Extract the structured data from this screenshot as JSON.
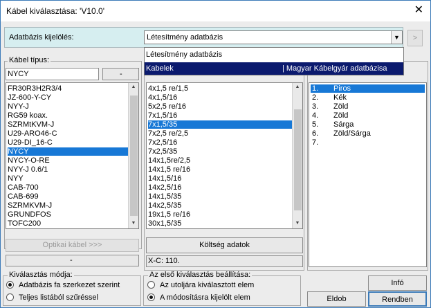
{
  "window": {
    "title": "Kábel kiválasztása: 'V10.0'"
  },
  "db_select": {
    "label": "Adatbázis kijelölés:",
    "value": "Létesítmény adatbázis",
    "next_label": ">",
    "options": [
      {
        "label": "Létesítmény adatbázis",
        "extra": ""
      },
      {
        "label": "Kabelek",
        "extra": "| Magyar Kábelgyár adatbázisa"
      }
    ]
  },
  "cable_type": {
    "title": "Kábel típus:",
    "current": "NYCY",
    "current_code": "-",
    "items": [
      "FR30R3H2R3/4",
      "JZ-600-Y-CY",
      "NYY-J",
      "RG59 koax.",
      "SZRMtKVM-J",
      "U29-ARO46-C",
      "U29-DI_16-C",
      "NYCY",
      "NYCY-O-RE",
      "NYY-J 0.6/1",
      "NYY",
      "CAB-700",
      "CAB-699",
      "SZRMKVM-J",
      "GRUNDFOS",
      "TOFC200"
    ],
    "selected_index": 7,
    "optical_button": "Optikai kábel >>>",
    "bottom_value": "-"
  },
  "section_list": {
    "items": [
      "4x1,5 re/1,5",
      "4x1,5/16",
      "5x2,5 re/16",
      "7x1,5/16",
      "7x1,5/35",
      "7x2,5 re/2,5",
      "7x2,5/16",
      "7x2,5/35",
      "14x1,5re/2,5",
      "14x1,5 re/16",
      "14x1,5/16",
      "14x2,5/16",
      "14x1,5/35",
      "14x2,5/35",
      "19x1,5 re/16",
      "30x1,5/35"
    ],
    "selected_index": 4,
    "cost_button": "Költség adatok",
    "status": "X-C:  110."
  },
  "wire_colors": {
    "items": [
      {
        "num": "1.",
        "color": "Piros"
      },
      {
        "num": "2.",
        "color": "Kék"
      },
      {
        "num": "3.",
        "color": "Zöld"
      },
      {
        "num": "4.",
        "color": "Zöld"
      },
      {
        "num": "5.",
        "color": "Sárga"
      },
      {
        "num": "6.",
        "color": "Zöld/Sárga"
      },
      {
        "num": "7.",
        "color": ""
      }
    ],
    "selected_index": 0
  },
  "select_mode": {
    "title": "Kiválasztás módja:",
    "options": [
      "Adatbázis fa szerkezet szerint",
      "Teljes listából szűréssel"
    ],
    "selected": 0
  },
  "first_select": {
    "title": "Az első kiválasztás beállítása:",
    "options": [
      "Az utoljára kiválasztott elem",
      "A módosításra kijelölt elem"
    ],
    "selected": 1
  },
  "buttons": {
    "info": "Infó",
    "back": "Eldob",
    "ok": "Rendben"
  }
}
